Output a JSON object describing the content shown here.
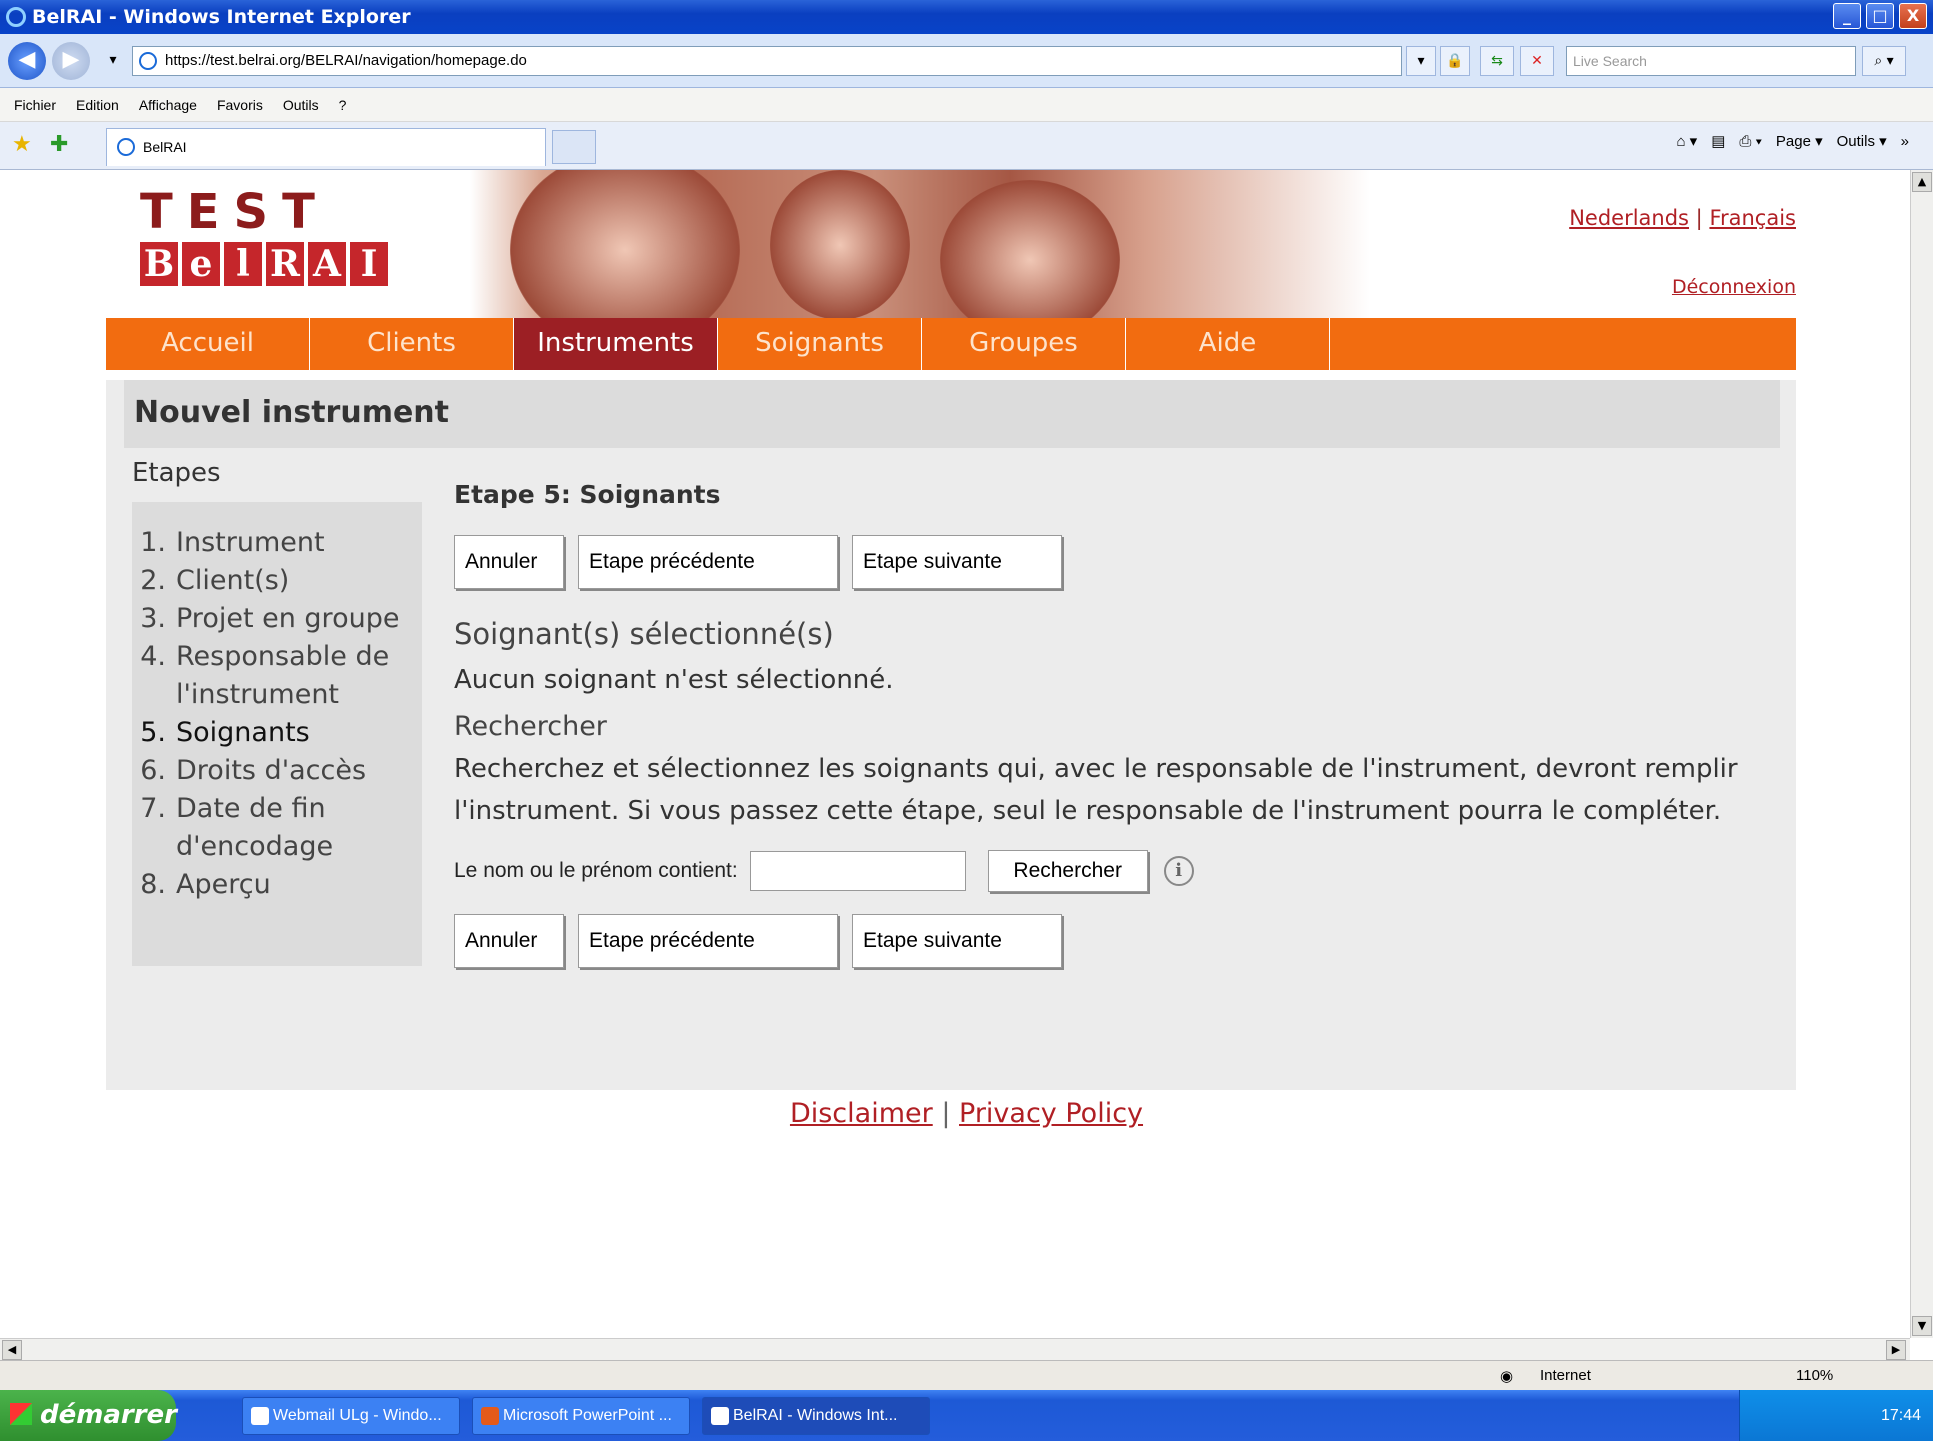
{
  "window": {
    "title": "BelRAI - Windows Internet Explorer",
    "minimize": "_",
    "maximize": "□",
    "close": "X"
  },
  "browser": {
    "url": "https://test.belrai.org/BELRAI/navigation/homepage.do",
    "search_placeholder": "Live Search",
    "menu": [
      "Fichier",
      "Edition",
      "Affichage",
      "Favoris",
      "Outils",
      "?"
    ],
    "tab_title": "BelRAI",
    "tools": [
      "Page ▾",
      "Outils ▾"
    ],
    "status_zone": "Internet",
    "zoom": "110%"
  },
  "site": {
    "logo_test": "TEST",
    "logo_belrai": [
      "B",
      "e",
      "l",
      "R",
      "A",
      "I"
    ],
    "lang_nl": "Nederlands",
    "lang_sep": "|",
    "lang_fr": "Français",
    "logout": "Déconnexion",
    "nav": [
      "Accueil",
      "Clients",
      "Instruments",
      "Soignants",
      "Groupes",
      "Aide"
    ],
    "nav_active": "Instruments",
    "page_title": "Nouvel instrument",
    "steps_label": "Etapes",
    "steps": [
      {
        "num": "1.",
        "label": "Instrument"
      },
      {
        "num": "2.",
        "label": "Client(s)"
      },
      {
        "num": "3.",
        "label": "Projet en groupe"
      },
      {
        "num": "4.",
        "label": "Responsable de l'instrument"
      },
      {
        "num": "5.",
        "label": "Soignants"
      },
      {
        "num": "6.",
        "label": "Droits d'accès"
      },
      {
        "num": "7.",
        "label": "Date de fin d'encodage"
      },
      {
        "num": "8.",
        "label": "Aperçu"
      }
    ],
    "current_step": "Soignants",
    "step_title": "Etape 5: Soignants",
    "buttons": {
      "cancel": "Annuler",
      "prev": "Etape précédente",
      "next": "Etape suivante",
      "search": "Rechercher"
    },
    "selected_heading": "Soignant(s) sélectionné(s)",
    "selected_text": "Aucun soignant n'est sélectionné.",
    "search_heading": "Rechercher",
    "search_text": "Recherchez et sélectionnez les soignants qui, avec le responsable de l'instrument, devront remplir l'instrument. Si vous passez cette étape, seul le responsable de l'instrument pourra le compléter.",
    "search_label": "Le nom ou le prénom contient:",
    "search_value": "",
    "info": "i",
    "footer_disclaimer": "Disclaimer",
    "footer_sep": "|",
    "footer_privacy": "Privacy Policy"
  },
  "taskbar": {
    "start": "démarrer",
    "tasks": [
      "Webmail ULg - Windo...",
      "Microsoft PowerPoint ...",
      "BelRAI - Windows Int..."
    ],
    "clock": "17:44"
  }
}
